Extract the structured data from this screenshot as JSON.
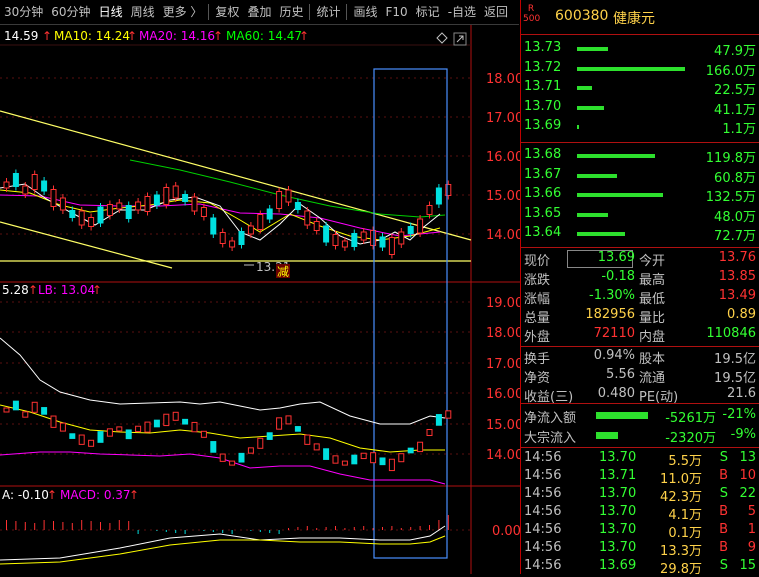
{
  "toolbar": {
    "items": [
      "30分钟",
      "60分钟",
      "日线",
      "周线",
      "更多 〉",
      "复权",
      "叠加",
      "历史",
      "统计",
      "画线",
      "F10",
      "标记",
      "-自选",
      "返回"
    ],
    "active": "日线"
  },
  "main_legend": {
    "ma5": "14.59",
    "ma10": "MA10: 14.24",
    "ma20": "MA20: 14.16",
    "ma60": "MA60: 14.47",
    "low_label": "13.21",
    "reduce_label": "减"
  },
  "price_axis": [
    "18.00",
    "17.00",
    "16.00",
    "15.00",
    "14.00"
  ],
  "sub_legend": {
    "ub": "5.28",
    "lb": "LB: 13.04"
  },
  "sub_axis": [
    "19.00",
    "18.00",
    "17.00",
    "16.00",
    "15.00",
    "14.00"
  ],
  "macd_legend": {
    "dea": "A: -0.10",
    "macd": "MACD: 0.37"
  },
  "macd_axis": [
    "0.00"
  ],
  "colors": {
    "up": "#ff3232",
    "down": "#00e0e0",
    "ma5": "#ffffff",
    "ma10": "#ffff00",
    "ma20": "#ff00ff",
    "ma60": "#00ff00",
    "frame": "#b01010",
    "box": "#4a90ff"
  },
  "stock": {
    "market_badge": "R 500",
    "code": "600380",
    "name": "健康元"
  },
  "orderbook": {
    "asks": [
      {
        "price": "13.73",
        "vol": "47.9万",
        "ratio": 0.29
      },
      {
        "price": "13.72",
        "vol": "166.0万",
        "ratio": 1.0
      },
      {
        "price": "13.71",
        "vol": "22.5万",
        "ratio": 0.14
      },
      {
        "price": "13.70",
        "vol": "41.1万",
        "ratio": 0.25
      },
      {
        "price": "13.69",
        "vol": "1.1万",
        "ratio": 0.02
      }
    ],
    "bids": [
      {
        "price": "13.68",
        "vol": "119.8万",
        "ratio": 0.72
      },
      {
        "price": "13.67",
        "vol": "60.8万",
        "ratio": 0.37
      },
      {
        "price": "13.66",
        "vol": "132.5万",
        "ratio": 0.8
      },
      {
        "price": "13.65",
        "vol": "48.0万",
        "ratio": 0.29
      },
      {
        "price": "13.64",
        "vol": "72.7万",
        "ratio": 0.44
      }
    ]
  },
  "quote": {
    "now_label": "现价",
    "now": "13.69",
    "open_label": "今开",
    "open": "13.76",
    "chg_label": "涨跌",
    "chg": "-0.18",
    "high_label": "最高",
    "high": "13.85",
    "pct_label": "涨幅",
    "pct": "-1.30%",
    "low_label": "最低",
    "low": "13.49",
    "vol_label": "总量",
    "vol": "182956",
    "vr_label": "量比",
    "vr": "0.89",
    "out_label": "外盘",
    "out": "72110",
    "in_label": "内盘",
    "in": "110846",
    "turn_label": "换手",
    "turn": "0.94%",
    "cap_label": "股本",
    "cap": "19.5亿",
    "nav_label": "净资",
    "nav": "5.56",
    "float_label": "流通",
    "float": "19.5亿",
    "eps_label": "收益(三)",
    "eps": "0.480",
    "pe_label": "PE(动)",
    "pe": "21.6"
  },
  "flow": {
    "net_label": "净流入额",
    "net": "-5261万",
    "net_pct": "-21%",
    "big_label": "大宗流入",
    "big": "-2320万",
    "big_pct": "-9%"
  },
  "ticks": [
    {
      "time": "14:56",
      "price": "13.70",
      "vol": "5.5万",
      "side": "S",
      "n": "13"
    },
    {
      "time": "14:56",
      "price": "13.71",
      "vol": "11.0万",
      "side": "B",
      "n": "10"
    },
    {
      "time": "14:56",
      "price": "13.70",
      "vol": "42.3万",
      "side": "S",
      "n": "22"
    },
    {
      "time": "14:56",
      "price": "13.70",
      "vol": "4.1万",
      "side": "B",
      "n": "5"
    },
    {
      "time": "14:56",
      "price": "13.70",
      "vol": "0.1万",
      "side": "B",
      "n": "1"
    },
    {
      "time": "14:56",
      "price": "13.70",
      "vol": "13.3万",
      "side": "B",
      "n": "9"
    },
    {
      "time": "14:56",
      "price": "13.69",
      "vol": "29.8万",
      "side": "S",
      "n": "15"
    }
  ]
}
